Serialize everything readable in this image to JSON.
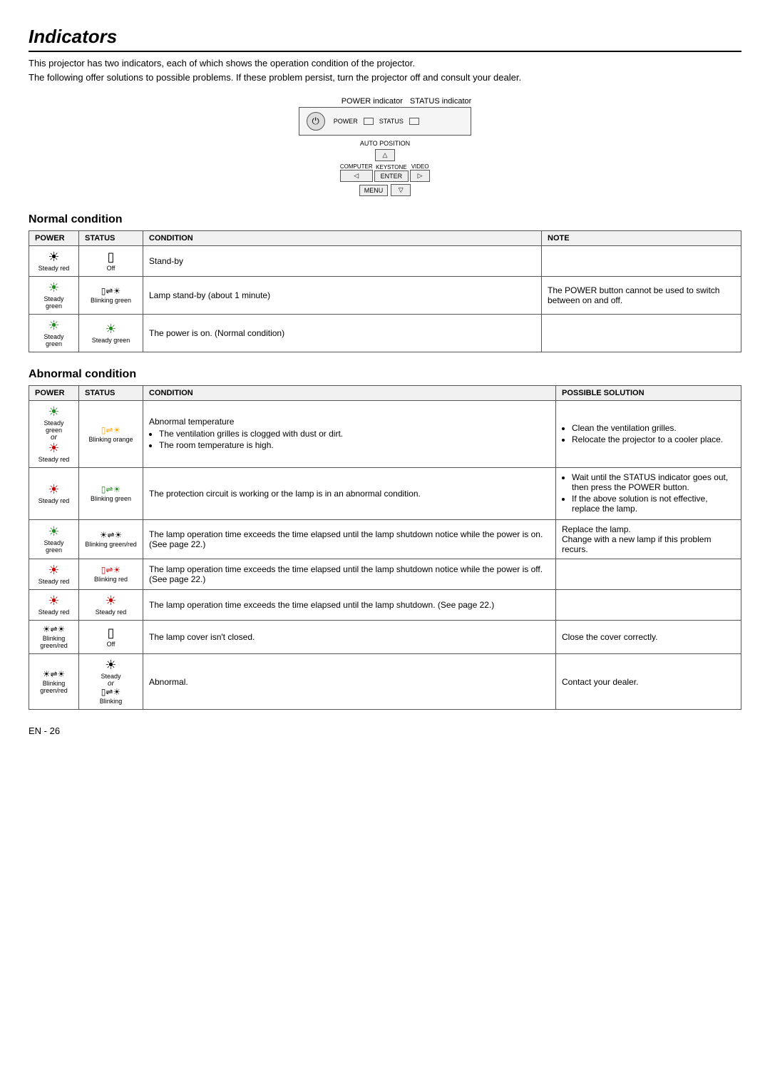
{
  "title": "Indicators",
  "intro": [
    "This projector has two indicators, each of which shows the operation condition of the projector.",
    "The following offer solutions to possible problems. If these problem persist, turn the projector off and consult your dealer."
  ],
  "diagram": {
    "power_label": "POWER indicator",
    "status_label": "STATUS indicator",
    "power_text": "POWER",
    "status_text": "STATUS",
    "auto_position_label": "AUTO POSITION",
    "computer_label": "COMPUTER",
    "keystone_label": "KEYSTONE",
    "video_label": "VIDEO",
    "menu_label": "MENU",
    "enter_label": "ENTER"
  },
  "normal_condition": {
    "title": "Normal condition",
    "headers": [
      "Power",
      "Status",
      "Condition",
      "Note"
    ],
    "rows": [
      {
        "power_icon": "☀",
        "power_label": "Steady red",
        "status_icon": "▯",
        "status_label": "Off",
        "condition": "Stand-by",
        "note": ""
      },
      {
        "power_icon": "☀",
        "power_label": "Steady green",
        "status_icon": "▯⇌☀",
        "status_label": "Blinking green",
        "condition": "Lamp stand-by (about 1 minute)",
        "note": "The POWER button cannot be used to switch between on and off."
      },
      {
        "power_icon": "☀",
        "power_label": "Steady green",
        "status_icon": "☀",
        "status_label": "Steady green",
        "condition": "The power is on. (Normal condition)",
        "note": ""
      }
    ]
  },
  "abnormal_condition": {
    "title": "Abnormal condition",
    "headers": [
      "Power",
      "Status",
      "Condition",
      "Possible Solution"
    ],
    "rows": [
      {
        "power_icon_top": "☀",
        "power_label_top": "Steady green",
        "power_or": "or",
        "power_icon_bot": "☀",
        "power_label_bot": "Steady red",
        "status_icon": "▯⇌☀",
        "status_label": "Blinking orange",
        "condition_title": "Abnormal temperature",
        "condition_bullets": [
          "The ventilation grilles is clogged with dust or dirt.",
          "The room temperature is high."
        ],
        "solution_bullets": [
          "Clean the ventilation grilles.",
          "Relocate the projector to a cooler place."
        ]
      },
      {
        "power_icon": "☀",
        "power_label": "Steady red",
        "status_icon": "▯⇌☀",
        "status_label": "Blinking green",
        "condition": "The protection circuit is working or the lamp is in an abnormal condition.",
        "solution_bullets": [
          "Wait until the STATUS indicator goes out, then press the POWER button.",
          "If the above solution is not effective, replace the lamp."
        ]
      },
      {
        "power_icon": "☀",
        "power_label": "Steady green",
        "status_icon": "☀⇌☀",
        "status_label": "Blinking green/red",
        "condition": "The lamp operation time exceeds the time elapsed until the lamp shutdown notice while the power is on. (See page 22.)",
        "solution": "Replace the lamp.\nChange with a new lamp if this problem recurs."
      },
      {
        "power_icon": "☀",
        "power_label": "Steady red",
        "status_icon": "▯⇌☀",
        "status_label": "Blinking red",
        "condition": "The lamp operation time exceeds the time elapsed until the lamp shutdown notice while the power is off. (See page 22.)",
        "solution": ""
      },
      {
        "power_icon": "☀",
        "power_label": "Steady red",
        "status_icon": "☀",
        "status_label": "Steady red",
        "condition": "The lamp operation time exceeds the time elapsed until the lamp shutdown. (See page 22.)",
        "solution": ""
      },
      {
        "power_icon": "☀⇌☀",
        "power_label": "Blinking green/red",
        "status_icon": "▯",
        "status_label": "Off",
        "condition": "The lamp cover isn't closed.",
        "solution": "Close the cover correctly."
      },
      {
        "power_icon_top": "☀⇌☀",
        "power_label_top": "Blinking green/red",
        "status_icon_top": "☀",
        "status_label_top": "Steady",
        "status_or": "or",
        "status_icon_bot": "▯⇌☀",
        "status_label_bot": "Blinking",
        "condition": "Abnormal.",
        "solution": "Contact your dealer."
      }
    ]
  },
  "page_number": "EN - 26"
}
